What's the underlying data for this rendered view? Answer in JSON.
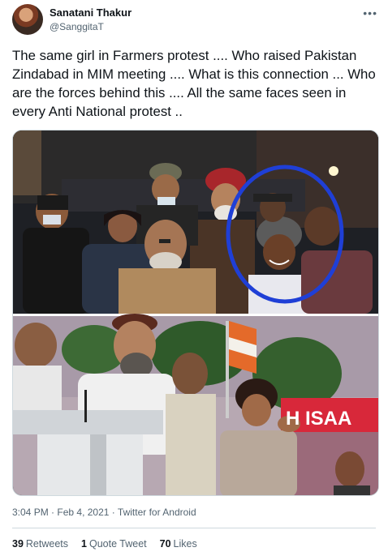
{
  "author": {
    "name": "Sanatani Thakur",
    "handle": "@SanggitaT"
  },
  "tweet": {
    "text": "The same girl in Farmers protest .... Who raised Pakistan Zindabad in MIM meeting .... What is this connection ... Who are the forces behind this .... All the same faces seen in every Anti National protest .."
  },
  "media": {
    "banner_text": "H ISAA"
  },
  "meta": {
    "time": "3:04 PM",
    "sep1": "·",
    "date": "Feb 4, 2021",
    "sep2": "·",
    "source": "Twitter for Android"
  },
  "stats": {
    "retweets_count": "39",
    "retweets_label": "Retweets",
    "quotes_count": "1",
    "quotes_label": "Quote Tweet",
    "likes_count": "70",
    "likes_label": "Likes"
  },
  "colors": {
    "highlight_circle": "#1f3fd6",
    "banner": "#d8283a",
    "text_secondary": "#536471"
  }
}
